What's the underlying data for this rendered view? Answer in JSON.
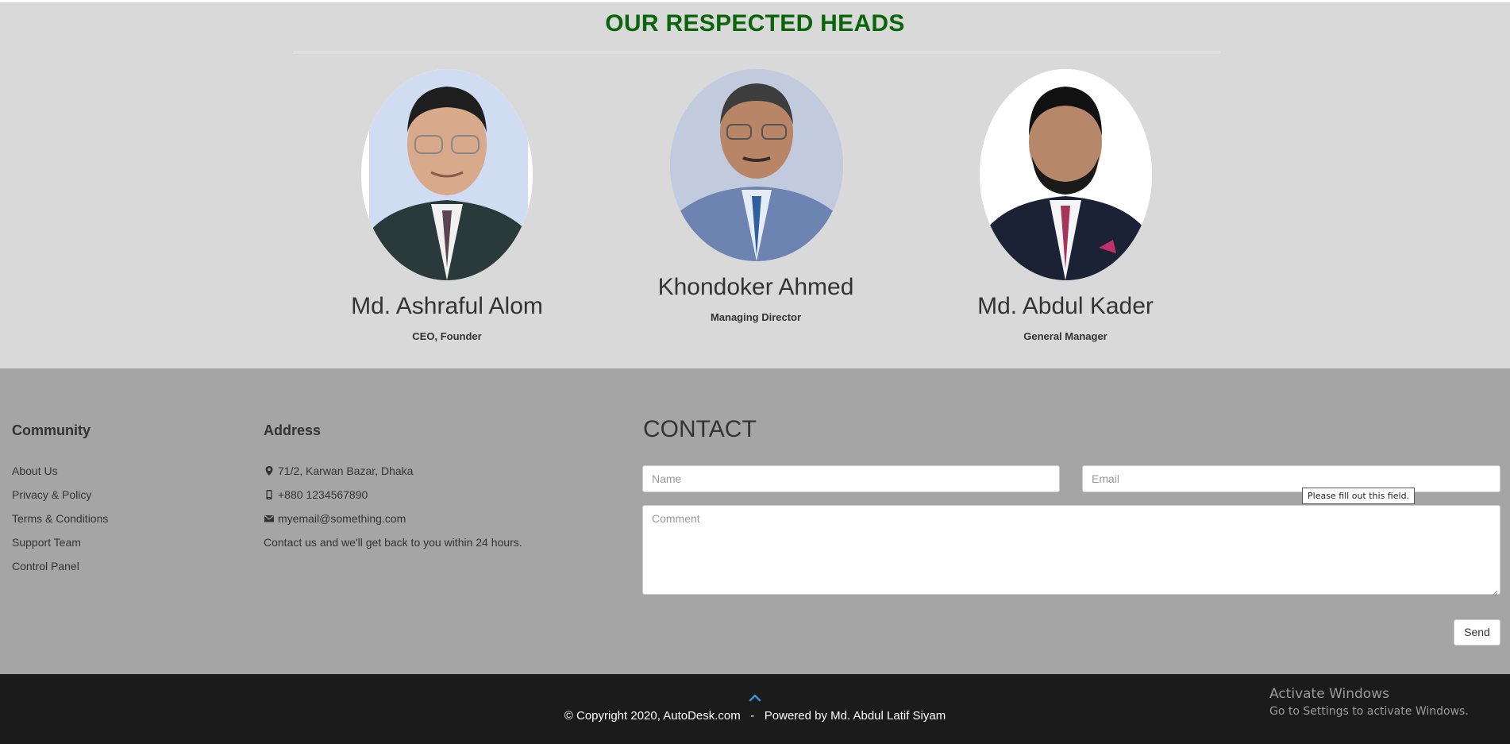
{
  "heads": {
    "title": "OUR RESPECTED HEADS",
    "people": [
      {
        "name": "Md. Ashraful Alom",
        "role": "CEO, Founder"
      },
      {
        "name": "Khondoker Ahmed",
        "role": "Managing Director"
      },
      {
        "name": "Md. Abdul Kader",
        "role": "General Manager"
      }
    ]
  },
  "footer": {
    "community": {
      "title": "Community",
      "links": [
        "About Us",
        "Privacy & Policy",
        "Terms & Conditions",
        "Support Team",
        "Control Panel"
      ]
    },
    "address": {
      "title": "Address",
      "location": "71/2, Karwan Bazar, Dhaka",
      "phone": "+880 1234567890",
      "email": "myemail@something.com",
      "note": "Contact us and we'll get back to you within 24 hours."
    },
    "contact": {
      "title": "CONTACT",
      "name_placeholder": "Name",
      "email_placeholder": "Email",
      "comment_placeholder": "Comment",
      "tooltip": "Please fill out this field.",
      "send_label": "Send"
    }
  },
  "bottom": {
    "copyright": "© Copyright 2020, AutoDesk.com   -   Powered by Md. Abdul Latif Siyam",
    "activate_title": "Activate Windows",
    "activate_sub": "Go to Settings to activate Windows."
  },
  "colors": {
    "heading_green": "#0a640a",
    "footer_bg": "#a5a5a5",
    "bottom_bg": "#1b1b1b",
    "arrow_blue": "#3a8fd8"
  }
}
